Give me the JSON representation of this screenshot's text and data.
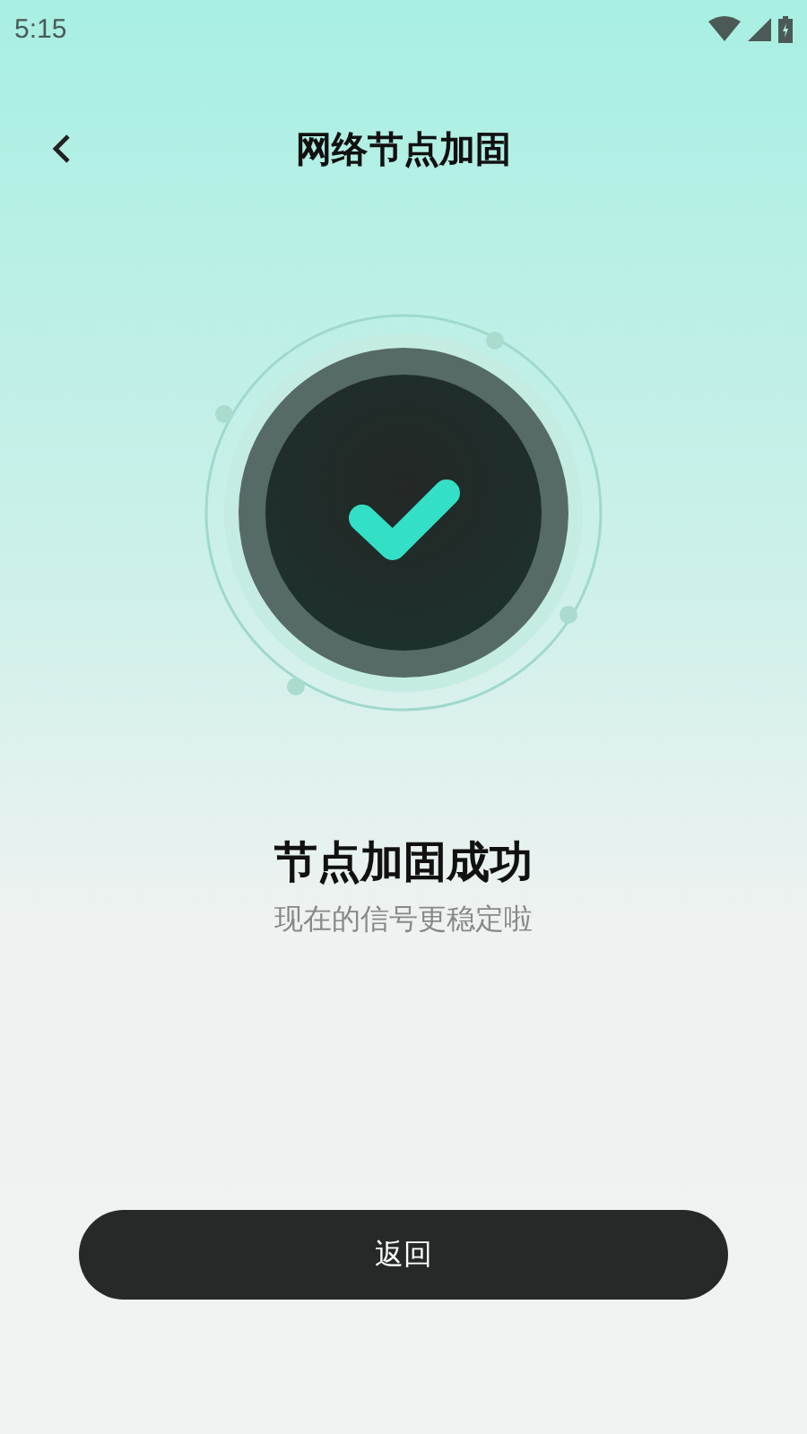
{
  "status_bar": {
    "time": "5:15"
  },
  "header": {
    "title": "网络节点加固"
  },
  "result": {
    "title": "节点加固成功",
    "subtitle": "现在的信号更稳定啦"
  },
  "buttons": [
    {
      "label": "返回"
    }
  ]
}
